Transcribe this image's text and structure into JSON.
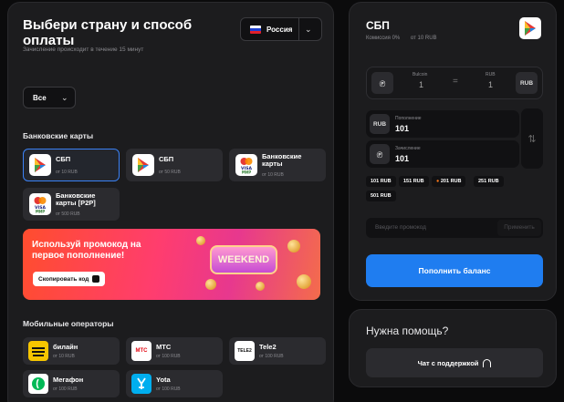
{
  "header": {
    "title": "Выбери страну и способ оплаты",
    "subtitle": "Зачисление происходит в течение 15 минут",
    "country": "Россия",
    "filter": "Все"
  },
  "bank_section": {
    "title": "Банковские карты",
    "items": [
      {
        "name": "СБП",
        "sub": "от 10 RUB",
        "icon": "sbp-icon",
        "selected": true
      },
      {
        "name": "СБП",
        "sub": "от 50 RUB",
        "icon": "sbp-icon",
        "selected": false
      },
      {
        "name": "Банковские карты",
        "sub": "от 10 RUB",
        "icon": "visa-mir-icon",
        "selected": false
      },
      {
        "name": "Банковские карты [P2P]",
        "sub": "от 500 RUB",
        "icon": "visa-mir-icon",
        "selected": false
      }
    ]
  },
  "banner": {
    "text": "Используй промокод на первое пополнение!",
    "button": "Скопировать код",
    "art_text": "WEEKEND"
  },
  "mobile_section": {
    "title": "Мобильные операторы",
    "items": [
      {
        "name": "билайн",
        "sub": "от 10 RUB",
        "icon": "beeline-icon"
      },
      {
        "name": "МТС",
        "sub": "от 100 RUB",
        "icon": "mts-icon",
        "icon_text": "МТС"
      },
      {
        "name": "Tele2",
        "sub": "от 100 RUB",
        "icon": "tele2-icon",
        "icon_text": "TELE2"
      },
      {
        "name": "Мегафон",
        "sub": "от 100 RUB",
        "icon": "megafon-icon"
      },
      {
        "name": "Yota",
        "sub": "от 100 RUB",
        "icon": "yota-icon"
      }
    ]
  },
  "payment": {
    "title": "СБП",
    "commission": "Комиссия 0%",
    "min": "от 10 RUB",
    "rate": {
      "left_label": "Bulcoin",
      "left_value": "1",
      "right_label": "RUB",
      "right_value": "1",
      "right_currency": "RUB"
    },
    "topup": {
      "label": "Пополнение",
      "value": "101",
      "currency": "RUB"
    },
    "credit": {
      "label": "Зачисление",
      "value": "101"
    },
    "presets": [
      "101 RUB",
      "151 RUB",
      "201 RUB",
      "251 RUB",
      "501 RUB"
    ],
    "promo_placeholder": "Введите промокод",
    "apply": "Применить",
    "pay_button": "Пополнить баланс"
  },
  "help": {
    "title": "Нужна помощь?",
    "button": "Чат с поддержкой"
  },
  "colors": {
    "accent": "#1f7df0",
    "selected_border": "#3b82f6",
    "panel": "#1c1c1e",
    "card": "#2b2b2f"
  }
}
